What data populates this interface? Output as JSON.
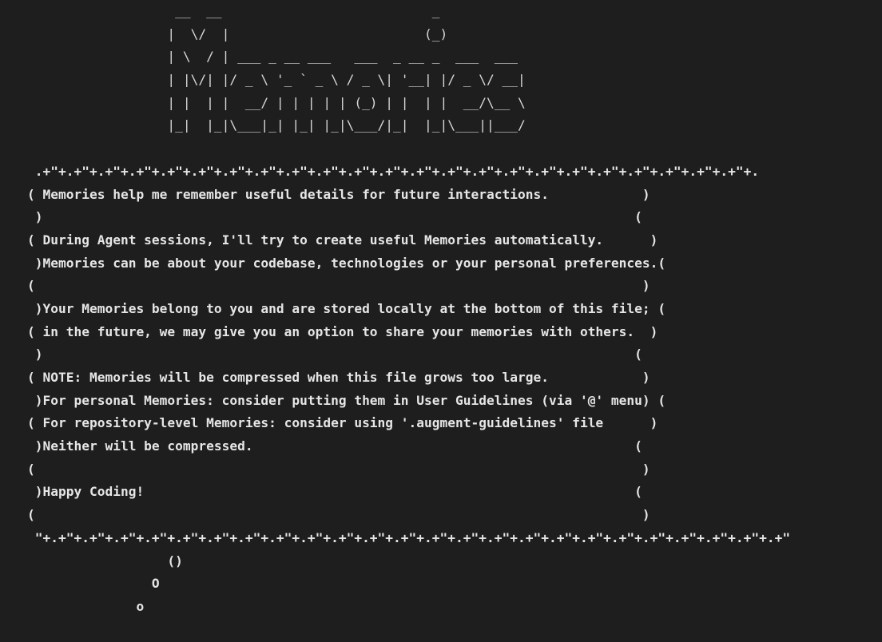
{
  "logo_art": [
    "                   __  __                           _",
    "                  |  \\/  |                         (_)",
    "                  | \\  / | ___ _ __ ___   ___  _ __ _  ___  ___",
    "                  | |\\/| |/ _ \\ '_ ` _ \\ / _ \\| '__| |/ _ \\/ __|",
    "                  | |  | |  __/ | | | | | (_) | |  | |  __/\\__ \\",
    "                  |_|  |_|\\___|_| |_| |_|\\___/|_|  |_|\\___||___/"
  ],
  "info_box": {
    "top_border": " .+\"+.+\"+.+\"+.+\"+.+\"+.+\"+.+\"+.+\"+.+\"+.+\"+.+\"+.+\"+.+\"+.+\"+.+\"+.+\"+.+\"+.+\"+.+\"+.+\"+.+\"+.+\"+.+\"+.",
    "lines": [
      "( Memories help me remember useful details for future interactions.            )",
      " )                                                                            (",
      "( During Agent sessions, I'll try to create useful Memories automatically.      )",
      " )Memories can be about your codebase, technologies or your personal preferences.(",
      "(                                                                              )",
      " )Your Memories belong to you and are stored locally at the bottom of this file; (",
      "( in the future, we may give you an option to share your memories with others.  )",
      " )                                                                            (",
      "( NOTE: Memories will be compressed when this file grows too large.            )",
      " )For personal Memories: consider putting them in User Guidelines (via '@' menu) (",
      "( For repository-level Memories: consider using '.augment-guidelines' file      )",
      " )Neither will be compressed.                                                 (",
      "(                                                                              )",
      " )Happy Coding!                                                               (",
      "(                                                                              )"
    ],
    "bottom_border": " \"+.+\"+.+\"+.+\"+.+\"+.+\"+.+\"+.+\"+.+\"+.+\"+.+\"+.+\"+.+\"+.+\"+.+\"+.+\"+.+\"+.+\"+.+\"+.+\"+.+\"+.+\"+.+\"+.+\"+.+\""
  },
  "thought_tail": [
    "                  ()",
    "                O",
    "              o"
  ]
}
